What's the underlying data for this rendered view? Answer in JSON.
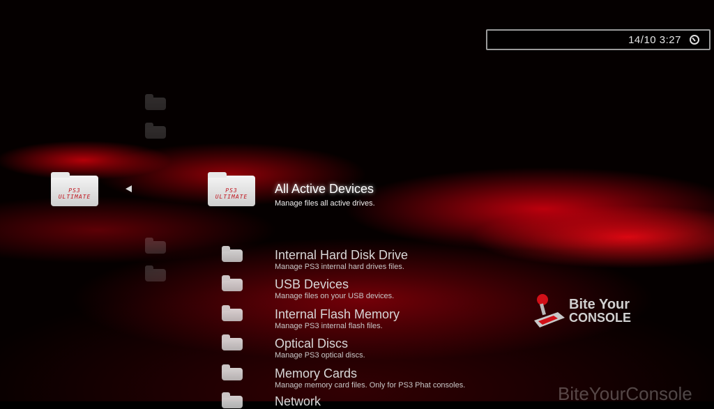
{
  "clock": {
    "time": "14/10 3:27",
    "icon": "clock-icon"
  },
  "category_folder": {
    "label": "PS3 ULTIMATE"
  },
  "selected": {
    "title": "All Active Devices",
    "description": "Manage files all active drives."
  },
  "items": [
    {
      "title": "Internal Hard Disk Drive",
      "description": "Manage PS3 internal hard drives files."
    },
    {
      "title": "USB Devices",
      "description": "Manage files on your USB devices."
    },
    {
      "title": "Internal Flash Memory",
      "description": "Manage PS3 internal flash files."
    },
    {
      "title": "Optical Discs",
      "description": "Manage PS3 optical discs."
    },
    {
      "title": "Memory Cards",
      "description": "Manage memory card files. Only for PS3 Phat consoles."
    },
    {
      "title": "Network",
      "description": ""
    }
  ],
  "brand": {
    "line1": "Bite Your",
    "line2": "CONSOLE",
    "watermark": "BiteYourConsole"
  },
  "colors": {
    "accent_red": "#d0101a",
    "folder_label": "#c0101a"
  }
}
